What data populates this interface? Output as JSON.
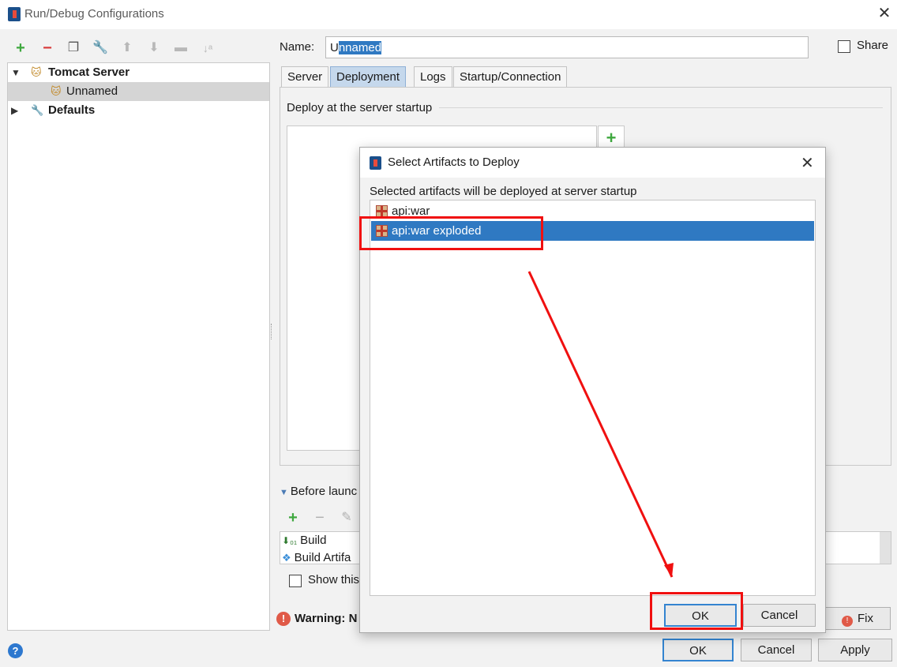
{
  "window": {
    "title": "Run/Debug Configurations"
  },
  "tree": {
    "group1": "Tomcat Server",
    "item1": "Unnamed",
    "group2": "Defaults"
  },
  "name_field": {
    "label": "Name:",
    "value_first": "U",
    "value_selected": "nnamed"
  },
  "share": {
    "label": "Share"
  },
  "tabs": [
    "Server",
    "Deployment",
    "Logs",
    "Startup/Connection"
  ],
  "deploy": {
    "label": "Deploy at the server startup",
    "add": "+"
  },
  "before_launch": {
    "label": "Before launc",
    "items": [
      "Build",
      "Build Artifa"
    ]
  },
  "show_page": {
    "label": "Show this"
  },
  "warning": {
    "label": "Warning: N",
    "fix": "Fix"
  },
  "buttons": {
    "ok": "OK",
    "cancel": "Cancel",
    "apply": "Apply",
    "help": "?"
  },
  "dialog": {
    "title": "Select Artifacts to Deploy",
    "hint": "Selected artifacts will be deployed at server startup",
    "artifacts": [
      "api:war",
      "api:war exploded"
    ],
    "selected_index": 1,
    "ok": "OK",
    "cancel": "Cancel"
  },
  "colors": {
    "selection": "#2f79c2",
    "annotation": "#f01010",
    "add_green": "#3fa83f",
    "remove_red": "#d83b3b"
  }
}
